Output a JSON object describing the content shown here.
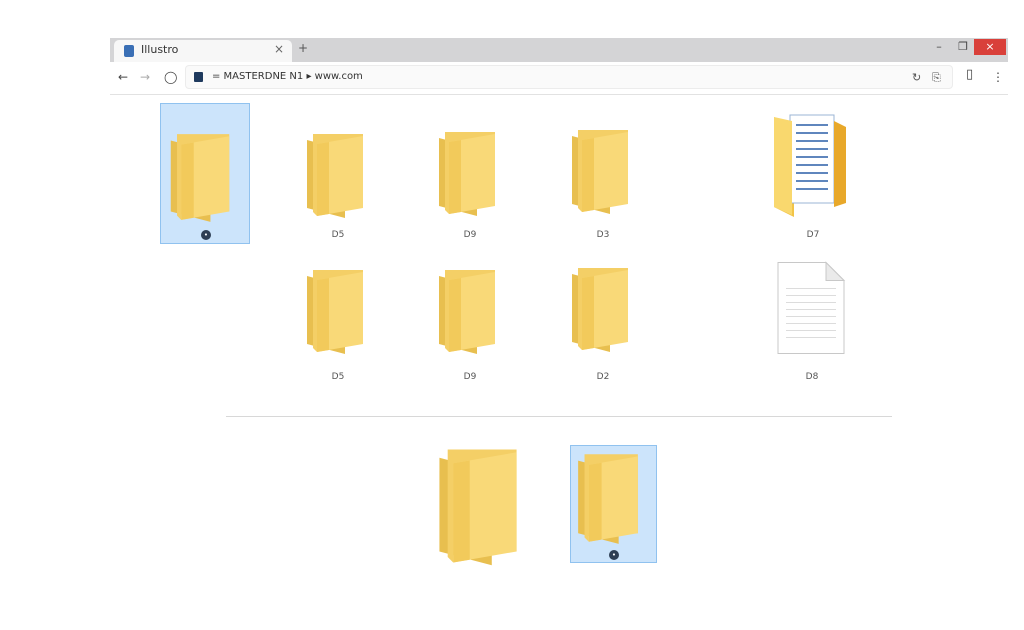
{
  "browser": {
    "tab_title": "Illustro",
    "tab_close": "×",
    "new_tab": "+",
    "window_controls": {
      "minimize": "–",
      "maximize": "❐",
      "close": "×"
    },
    "toolbar": {
      "back": "←",
      "forward": "→",
      "shield": "◯"
    },
    "address": "= MASTERDNE N1  ▸  www.com",
    "address_right": {
      "refresh": "↻",
      "ext": "⎘",
      "menu": "⋮"
    }
  },
  "items": [
    {
      "name": "folder-selected-top",
      "label": "",
      "badge": "•"
    },
    {
      "name": "folder-d5",
      "label": "D5"
    },
    {
      "name": "folder-d9",
      "label": "D9"
    },
    {
      "name": "folder-d3",
      "label": "D3"
    },
    {
      "name": "folder-with-docs-d7",
      "label": "D7"
    },
    {
      "name": "folder-d5-b",
      "label": "D5"
    },
    {
      "name": "folder-d9-b",
      "label": "D9"
    },
    {
      "name": "folder-d2",
      "label": "D2"
    },
    {
      "name": "text-file-d8",
      "label": "D8"
    },
    {
      "name": "folder-large-bottom",
      "label": ""
    },
    {
      "name": "folder-selected-bottom",
      "label": "",
      "badge": "•"
    }
  ],
  "colors": {
    "folder_front": "#f8d775",
    "folder_back": "#e8bf4f",
    "selection": "#cce4fb",
    "selection_border": "#90c2ef"
  }
}
